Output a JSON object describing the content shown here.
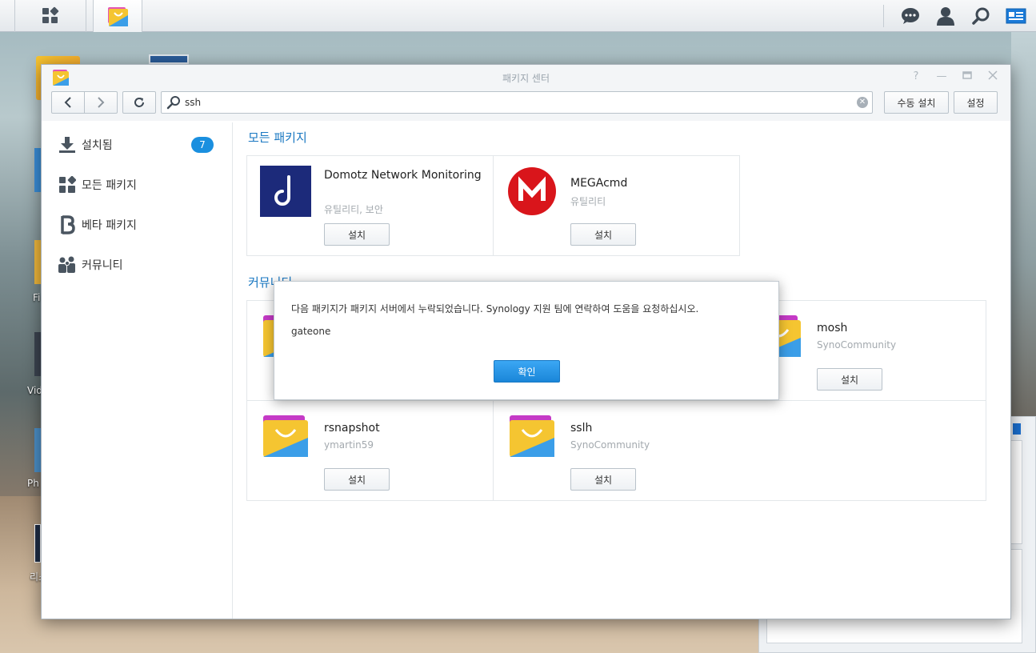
{
  "window": {
    "title": "패키지 센터"
  },
  "toolbar": {
    "search_value": "ssh",
    "manual_install_label": "수동 설치",
    "settings_label": "설정"
  },
  "sidebar": {
    "items": [
      {
        "label": "설치됨",
        "badge": "7",
        "icon": "download-icon"
      },
      {
        "label": "모든 패키지",
        "icon": "grid-icon"
      },
      {
        "label": "베타 패키지",
        "icon": "beta-icon"
      },
      {
        "label": "커뮤니티",
        "icon": "people-icon"
      }
    ]
  },
  "sections": {
    "all_packages_title": "모든 패키지",
    "community_title": "커뮤니티"
  },
  "all_packages": [
    {
      "name": "Domotz Network Monitoring",
      "category": "유틸리티, 보안",
      "button": "설치",
      "icon": "domotz-icon"
    },
    {
      "name": "MEGAcmd",
      "category": "유틸리티",
      "button": "설치",
      "icon": "mega-icon"
    }
  ],
  "community": [
    {
      "name": "mosh",
      "publisher": "SynoCommunity",
      "button": "설치",
      "icon": "package-icon"
    },
    {
      "name": "rsnapshot",
      "publisher": "ymartin59",
      "button": "설치",
      "icon": "package-icon"
    },
    {
      "name": "sslh",
      "publisher": "SynoCommunity",
      "button": "설치",
      "icon": "package-icon"
    }
  ],
  "modal": {
    "message": "다음 패키지가 패키지 서버에서 누락되었습니다. Synology 지원 팀에 연락하여 도움을 요청하십시오.",
    "item": "gateone",
    "ok_label": "확인"
  },
  "desktop": {
    "labels": [
      "Fi",
      "Vid",
      "Ph",
      "리소"
    ]
  },
  "colors": {
    "accent": "#1a8fdf",
    "section_title": "#1a78c2",
    "mega_red": "#d9151b",
    "domotz_navy": "#1c2a7a"
  }
}
